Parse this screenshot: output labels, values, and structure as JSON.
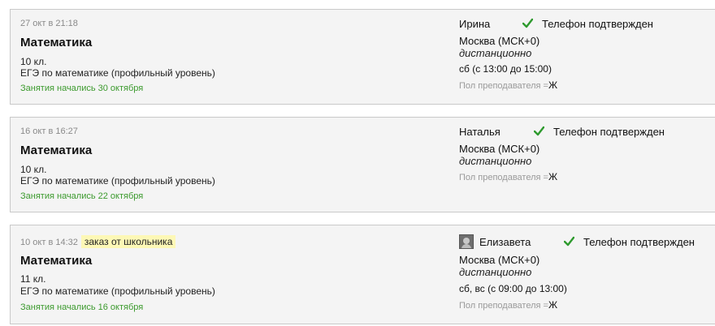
{
  "requests": [
    {
      "timestamp": "27 окт в 21:18",
      "badge": "",
      "subject": "Математика",
      "grade": "10 кл.",
      "exam": "ЕГЭ по математике (профильный уровень)",
      "started": "Занятия начались 30 октября",
      "student_name": "Ирина",
      "has_avatar": false,
      "phone_status": "Телефон подтвержден",
      "city": "Москва (МСК+0)",
      "mode": "дистанционно",
      "schedule": "сб (с 13:00 до 15:00)",
      "gender_label": "Пол преподавателя =",
      "gender_value": "Ж"
    },
    {
      "timestamp": "16 окт в 16:27",
      "badge": "",
      "subject": "Математика",
      "grade": "10 кл.",
      "exam": "ЕГЭ по математике (профильный уровень)",
      "started": "Занятия начались 22 октября",
      "student_name": "Наталья",
      "has_avatar": false,
      "phone_status": "Телефон подтвержден",
      "city": "Москва (МСК+0)",
      "mode": "дистанционно",
      "schedule": "",
      "gender_label": "Пол преподавателя =",
      "gender_value": "Ж"
    },
    {
      "timestamp": "10 окт в 14:32",
      "badge": "заказ от школьника",
      "subject": "Математика",
      "grade": "11 кл.",
      "exam": "ЕГЭ по математике (профильный уровень)",
      "started": "Занятия начались 16 октября",
      "student_name": "Елизавета",
      "has_avatar": true,
      "phone_status": "Телефон подтвержден",
      "city": "Москва (МСК+0)",
      "mode": "дистанционно",
      "schedule": "сб, вс (с 09:00 до 13:00)",
      "gender_label": "Пол преподавателя =",
      "gender_value": "Ж"
    }
  ],
  "colors": {
    "card_bg": "#f4f4f4",
    "border": "#c9c9c9",
    "started_green": "#3c9a2e",
    "check_green": "#2e9a2e",
    "badge_yellow": "#fdf8b6"
  },
  "icons": {
    "check": "check-icon",
    "avatar": "avatar-icon"
  }
}
